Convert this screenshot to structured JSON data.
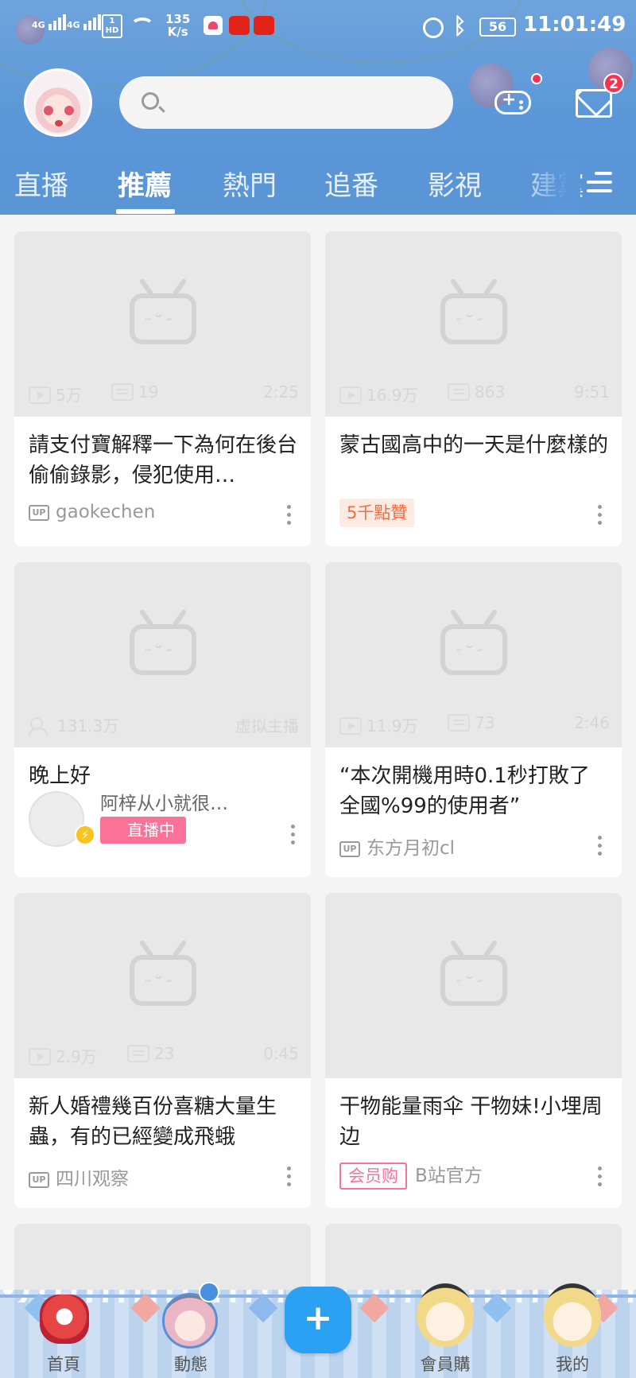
{
  "status_bar": {
    "net1": "4G",
    "net2": "4G",
    "hd_top": "1",
    "hd_bottom": "HD",
    "speed_value": "135",
    "speed_unit": "K/s",
    "battery": "56",
    "time": "11:01:49"
  },
  "header": {
    "search_placeholder": "",
    "mail_badge": "2"
  },
  "tabs": [
    {
      "label": "直播"
    },
    {
      "label": "推薦"
    },
    {
      "label": "熱門"
    },
    {
      "label": "追番"
    },
    {
      "label": "影視"
    },
    {
      "label": "建黨"
    }
  ],
  "active_tab": "推薦",
  "cards": [
    {
      "plays": "5万",
      "danmaku": "19",
      "duration": "2:25",
      "title": "請支付寶解釋一下為何在後台偷偷錄影，侵犯使用…",
      "uploader": "gaokechen"
    },
    {
      "plays": "16.9万",
      "danmaku": "863",
      "duration": "9:51",
      "title": "蒙古國高中的一天是什麼樣的",
      "tag": "5千點贊"
    },
    {
      "viewers": "131.3万",
      "category": "虚拟主播",
      "title": "晚上好",
      "streamer": "阿梓从小就很…",
      "live_tag": "直播中"
    },
    {
      "plays": "11.9万",
      "danmaku": "73",
      "duration": "2:46",
      "title": "“本次開機用時0.1秒打敗了全國%99的使用者”",
      "uploader": "东方月初cl"
    },
    {
      "plays": "2.9万",
      "danmaku": "23",
      "duration": "0:45",
      "title": "新人婚禮幾百份喜糖大量生蟲，有的已經變成飛蛾",
      "uploader": "四川观察"
    },
    {
      "title": "干物能量雨伞 干物妹!小埋周边",
      "tag": "会员购",
      "uploader": "B站官方"
    }
  ],
  "up_label": "UP",
  "bottom_nav": [
    {
      "label": "首頁",
      "icon": "drum-icon"
    },
    {
      "label": "動態",
      "icon": "avatar-icon"
    },
    {
      "label": "+",
      "icon": "plus-icon"
    },
    {
      "label": "會員購",
      "icon": "chibi-icon"
    },
    {
      "label": "我的",
      "icon": "chibi-icon"
    }
  ],
  "colors": {
    "header": "#5b97d8",
    "accent_pink": "#fb7299",
    "plus_blue": "#2aa1f3",
    "badge_red": "#f5324f"
  }
}
